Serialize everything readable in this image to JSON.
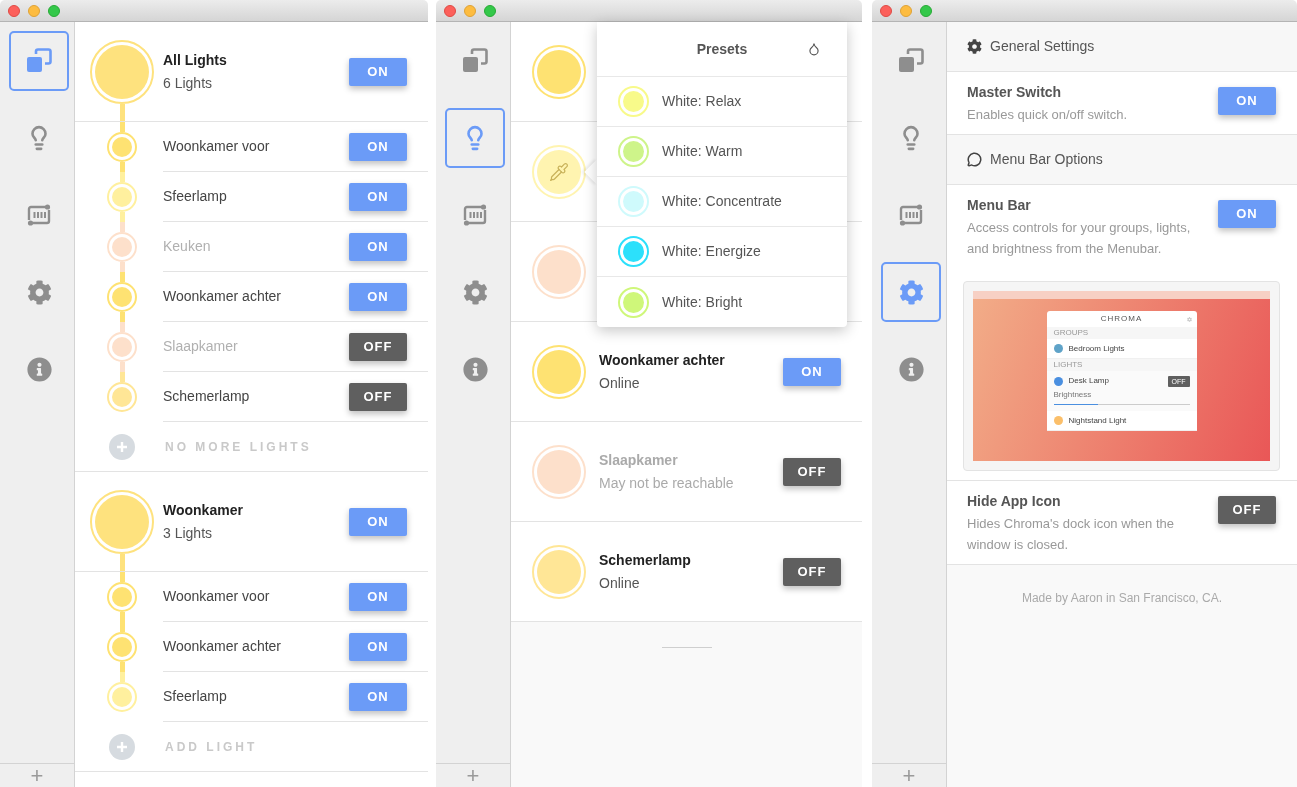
{
  "windows": [
    {
      "sidebar": {
        "items": [
          {
            "kind": "groups",
            "selected": true
          },
          {
            "kind": "lights",
            "selected": false
          },
          {
            "kind": "scenes",
            "selected": false
          },
          {
            "kind": "settings",
            "selected": false
          },
          {
            "kind": "about",
            "selected": false
          }
        ],
        "add": "+"
      },
      "groups": [
        {
          "name": "All Lights",
          "count": "6 Lights",
          "color": "#fee27e",
          "on": true,
          "toggle": "ON",
          "footer": "NO MORE LIGHTS",
          "lights": [
            {
              "name": "Woonkamer voor",
              "color": "#fee272",
              "reachable": true,
              "on": true,
              "toggle": "ON"
            },
            {
              "name": "Sfeerlamp",
              "color": "#fff09e",
              "reachable": true,
              "on": true,
              "toggle": "ON"
            },
            {
              "name": "Keuken",
              "color": "#fde0cb",
              "reachable": false,
              "on": true,
              "toggle": "ON"
            },
            {
              "name": "Woonkamer achter",
              "color": "#fee272",
              "reachable": true,
              "on": true,
              "toggle": "ON"
            },
            {
              "name": "Slaapkamer",
              "color": "#fde0cb",
              "reachable": false,
              "on": false,
              "toggle": "OFF"
            },
            {
              "name": "Schemerlamp",
              "color": "#ffe696",
              "reachable": true,
              "on": false,
              "toggle": "OFF"
            }
          ]
        },
        {
          "name": "Woonkamer",
          "count": "3 Lights",
          "color": "#fee27e",
          "on": true,
          "toggle": "ON",
          "footer": "ADD LIGHT",
          "lights": [
            {
              "name": "Woonkamer voor",
              "color": "#fee272",
              "reachable": true,
              "on": true,
              "toggle": "ON"
            },
            {
              "name": "Woonkamer achter",
              "color": "#fee272",
              "reachable": true,
              "on": true,
              "toggle": "ON"
            },
            {
              "name": "Sfeerlamp",
              "color": "#fff09e",
              "reachable": true,
              "on": true,
              "toggle": "ON"
            }
          ]
        }
      ]
    },
    {
      "sidebar": {
        "items": [
          {
            "kind": "groups",
            "selected": false
          },
          {
            "kind": "lights",
            "selected": true
          },
          {
            "kind": "scenes",
            "selected": false
          },
          {
            "kind": "settings",
            "selected": false
          },
          {
            "kind": "about",
            "selected": false
          }
        ],
        "add": "+"
      },
      "lights": [
        {
          "color": "#fee272",
          "picking": false
        },
        {
          "color": "#fff4b0",
          "picking": true
        },
        {
          "color": "#fde0cb",
          "picking": false
        },
        {
          "name": "Woonkamer achter",
          "status": "Online",
          "color": "#fee272",
          "reachable": true,
          "on": true,
          "toggle": "ON",
          "picking": false
        },
        {
          "name": "Slaapkamer",
          "status": "May not be reachable",
          "color": "#fde0cb",
          "reachable": false,
          "on": false,
          "toggle": "OFF",
          "picking": false
        },
        {
          "name": "Schemerlamp",
          "status": "Online",
          "color": "#ffe696",
          "reachable": true,
          "on": false,
          "toggle": "OFF",
          "picking": false
        }
      ],
      "presets": {
        "title": "Presets",
        "items": [
          {
            "label": "White: Relax",
            "color": "#f8fa8a"
          },
          {
            "label": "White: Warm",
            "color": "#cef48a"
          },
          {
            "label": "White: Concentrate",
            "color": "#cffafc"
          },
          {
            "label": "White: Energize",
            "color": "#2ce0fb"
          },
          {
            "label": "White: Bright",
            "color": "#cff77a"
          }
        ]
      }
    },
    {
      "sidebar": {
        "items": [
          {
            "kind": "groups",
            "selected": false
          },
          {
            "kind": "lights",
            "selected": false
          },
          {
            "kind": "scenes",
            "selected": false
          },
          {
            "kind": "settings",
            "selected": true
          },
          {
            "kind": "about",
            "selected": false
          }
        ],
        "add": "+"
      },
      "sections": [
        {
          "kind": "header",
          "label": "General Settings"
        },
        {
          "kind": "setting",
          "title": "Master Switch",
          "description": "Enables quick on/off switch.",
          "on": true,
          "toggle": "ON"
        },
        {
          "kind": "header",
          "label": "Menu Bar Options"
        },
        {
          "kind": "setting",
          "title": "Menu Bar",
          "description": "Access controls for your groups, lights, and brightness from the Menubar.",
          "on": true,
          "toggle": "ON",
          "preview": {
            "title": "CHROMA",
            "blocks": [
              {
                "kind": "heading",
                "text": "GROUPS"
              },
              {
                "kind": "item",
                "text": "Bedroom Lights",
                "color": "#5fa3c8"
              },
              {
                "kind": "heading",
                "text": "LIGHTS"
              },
              {
                "kind": "control",
                "text": "Desk Lamp",
                "color": "#4a8fe0",
                "toggle": "OFF",
                "slider_label": "Brightness",
                "level": 0.33
              },
              {
                "kind": "item",
                "text": "Nightstand Light",
                "color": "#fbbf6a"
              }
            ]
          }
        },
        {
          "kind": "setting",
          "title": "Hide App Icon",
          "description": "Hides Chroma's dock icon when the window is closed.",
          "on": false,
          "toggle": "OFF"
        }
      ],
      "footer": "Made by Aaron in San Francisco, CA."
    }
  ]
}
